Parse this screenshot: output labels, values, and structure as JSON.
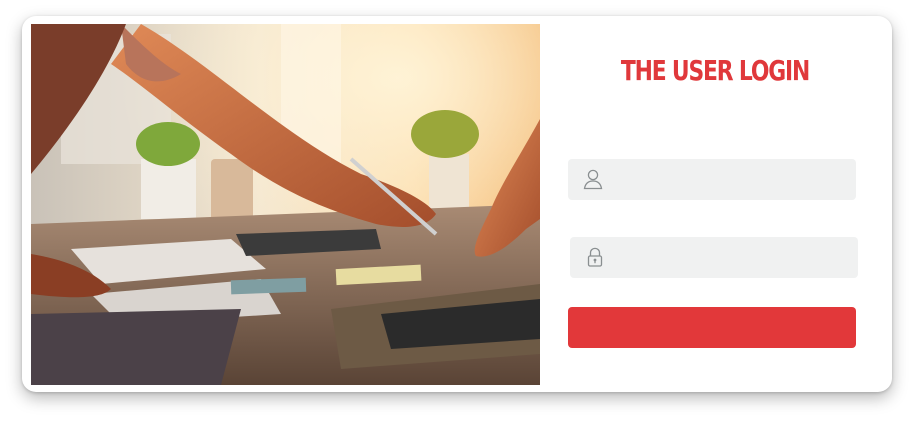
{
  "login": {
    "title": "THE USER LOGIN",
    "username": {
      "value": "",
      "placeholder": "",
      "icon": "user-icon"
    },
    "password": {
      "value": "",
      "placeholder": "",
      "icon": "lock-icon"
    },
    "submit_label": ""
  },
  "colors": {
    "accent": "#e2383a",
    "field_bg": "#f0f1f1",
    "icon": "#8a8f91"
  },
  "hero_image": {
    "description_icon": "photo-image"
  }
}
